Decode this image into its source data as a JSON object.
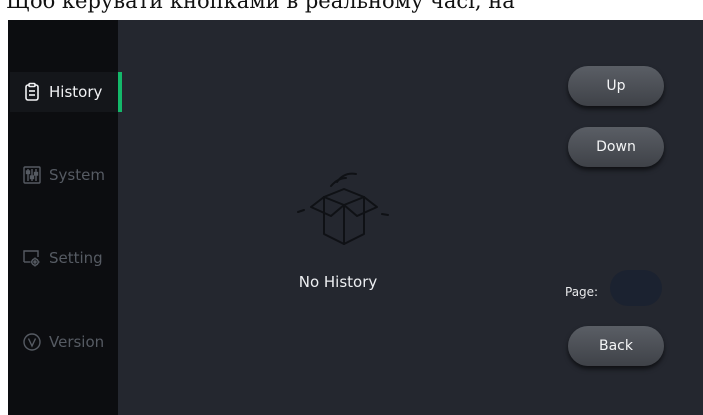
{
  "caption": "Щоб керувати кнопками в реальному часі, на",
  "sidebar": {
    "items": [
      {
        "label": "History",
        "icon": "clipboard-icon",
        "active": true
      },
      {
        "label": "System",
        "icon": "sliders-icon",
        "active": false
      },
      {
        "label": "Setting",
        "icon": "settings-icon",
        "active": false
      },
      {
        "label": "Version",
        "icon": "version-icon",
        "active": false
      }
    ]
  },
  "main": {
    "empty_icon": "empty-box-icon",
    "empty_text": "No History"
  },
  "controls": {
    "up_label": "Up",
    "down_label": "Down",
    "page_label": "Page:",
    "page_value": "",
    "back_label": "Back"
  },
  "colors": {
    "background": "#24272f",
    "sidebar": "#0c0d10",
    "active_indicator": "#14b86a"
  }
}
